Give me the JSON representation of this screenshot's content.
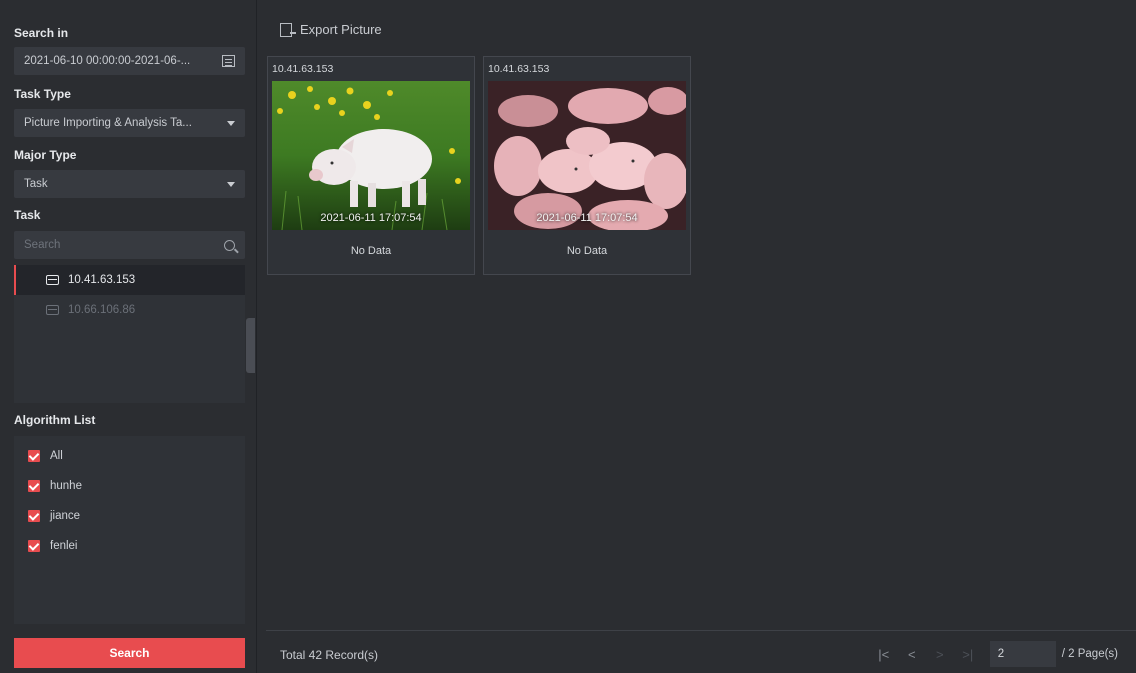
{
  "left_panel": {
    "search_in_label": "Search in",
    "time_range": "2021-06-10 00:00:00-2021-06-...",
    "task_type_label": "Task Type",
    "task_type_value": "Picture Importing & Analysis Ta...",
    "major_type_label": "Major Type",
    "major_type_value": "Task",
    "task_label": "Task",
    "task_search_placeholder": "Search",
    "task_items": [
      {
        "label": "10.41.63.153",
        "selected": true
      },
      {
        "label": "10.66.106.86",
        "selected": false
      }
    ],
    "algorithm_list_label": "Algorithm List",
    "algorithms": [
      {
        "label": "All",
        "checked": true
      },
      {
        "label": "hunhe",
        "checked": true
      },
      {
        "label": "jiance",
        "checked": true
      },
      {
        "label": "fenlei",
        "checked": true
      }
    ],
    "search_button": "Search"
  },
  "toolbar": {
    "export_label": "Export Picture"
  },
  "results": [
    {
      "ip": "10.41.63.153",
      "timestamp": "2021-06-11 17:07:54",
      "status": "No Data",
      "image": "pig-on-grass"
    },
    {
      "ip": "10.41.63.153",
      "timestamp": "2021-06-11 17:07:54",
      "status": "No Data",
      "image": "piglets-group"
    }
  ],
  "footer": {
    "total": "Total 42 Record(s)",
    "current_page": "2",
    "page_total": "/ 2 Page(s)"
  },
  "colors": {
    "accent": "#e84c4f",
    "background": "#2b2d31",
    "panel": "#2f3237",
    "field": "#373a40"
  }
}
